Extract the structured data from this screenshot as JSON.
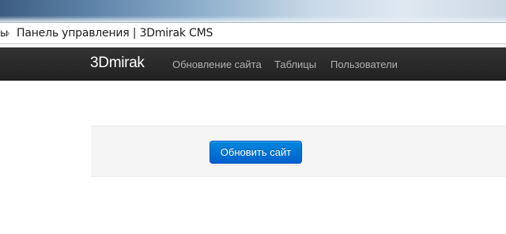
{
  "window": {
    "crumb_fragment": "ы",
    "crumb_separator": "›",
    "page_title": "Панель управления | 3Dmirak CMS"
  },
  "navbar": {
    "brand": "3Dmirak",
    "items": [
      {
        "label": "Обновление сайта"
      },
      {
        "label": "Таблицы"
      },
      {
        "label": "Пользователи"
      }
    ]
  },
  "main": {
    "update_button_label": "Обновить сайт"
  },
  "colors": {
    "navbar_bg": "#222222",
    "brand_text": "#ffffff",
    "nav_text": "#b0b0b0",
    "button_primary": "#0074cc",
    "well_bg": "#f5f5f5"
  }
}
